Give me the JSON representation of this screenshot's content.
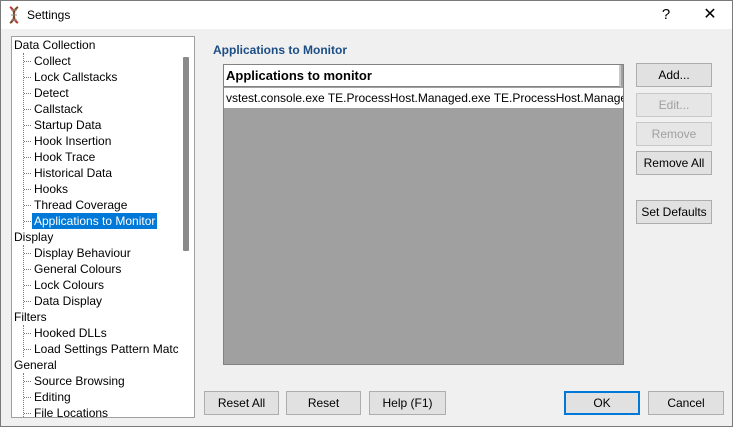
{
  "window": {
    "title": "Settings",
    "help_glyph": "?",
    "close_glyph": "✕"
  },
  "tree": {
    "items": [
      {
        "label": "Data Collection",
        "level": 0
      },
      {
        "label": "Collect",
        "level": 1
      },
      {
        "label": "Lock Callstacks",
        "level": 1
      },
      {
        "label": "Detect",
        "level": 1
      },
      {
        "label": "Callstack",
        "level": 1
      },
      {
        "label": "Startup Data",
        "level": 1
      },
      {
        "label": "Hook Insertion",
        "level": 1
      },
      {
        "label": "Hook Trace",
        "level": 1
      },
      {
        "label": "Historical Data",
        "level": 1
      },
      {
        "label": "Hooks",
        "level": 1
      },
      {
        "label": "Thread Coverage",
        "level": 1
      },
      {
        "label": "Applications to Monitor",
        "level": 1,
        "selected": true
      },
      {
        "label": "Display",
        "level": 0
      },
      {
        "label": "Display Behaviour",
        "level": 1
      },
      {
        "label": "General Colours",
        "level": 1
      },
      {
        "label": "Lock Colours",
        "level": 1
      },
      {
        "label": "Data Display",
        "level": 1
      },
      {
        "label": "Filters",
        "level": 0
      },
      {
        "label": "Hooked DLLs",
        "level": 1
      },
      {
        "label": "Load Settings Pattern Match",
        "level": 1
      },
      {
        "label": "General",
        "level": 0
      },
      {
        "label": "Source Browsing",
        "level": 1
      },
      {
        "label": "Editing",
        "level": 1
      },
      {
        "label": "File Locations",
        "level": 1
      }
    ]
  },
  "panel": {
    "heading": "Applications to Monitor",
    "list_header": "Applications to monitor",
    "rows": [
      "vstest.console.exe TE.ProcessHost.Managed.exe TE.ProcessHost.Manage..."
    ]
  },
  "side_buttons": {
    "add": "Add...",
    "edit": "Edit...",
    "remove": "Remove",
    "remove_all": "Remove All",
    "set_defaults": "Set Defaults"
  },
  "bottom_buttons": {
    "reset_all": "Reset All",
    "reset": "Reset",
    "help": "Help (F1)",
    "ok": "OK",
    "cancel": "Cancel"
  },
  "colors": {
    "selection": "#0078d7",
    "heading": "#1c4e84",
    "list_background": "#a0a0a0"
  }
}
